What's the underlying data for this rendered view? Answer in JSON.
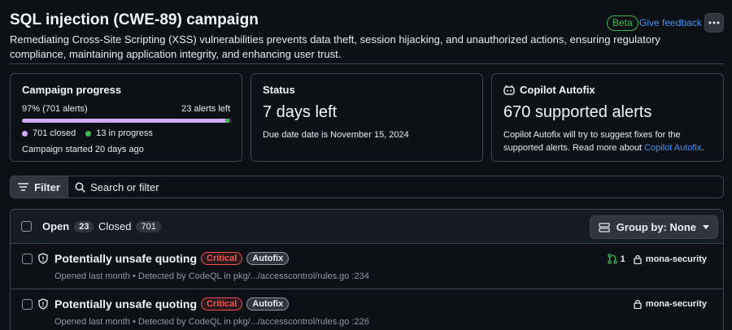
{
  "header": {
    "title": "SQL injection (CWE-89) campaign",
    "description": "Remediating Cross-Site Scripting (XSS) vulnerabilities prevents data theft, session hijacking, and unauthorized actions, ensuring regulatory compliance, maintaining application integrity, and enhancing user trust.",
    "beta_label": "Beta",
    "feedback_label": "Give feedback",
    "more_icon": "kebab-horizontal-icon"
  },
  "progress_card": {
    "title": "Campaign progress",
    "percent_label": "97% (701 alerts)",
    "remaining_label": "23 alerts left",
    "progress_fraction": 0.97,
    "closed_label": "701 closed",
    "in_progress_label": "13 in progress",
    "started_label": "Campaign started 20 days ago",
    "closed_color": "#d2a8ff",
    "in_progress_color": "#3fb950"
  },
  "status_card": {
    "title": "Status",
    "value": "7 days left",
    "due_label": "Due date date is November 15, 2024"
  },
  "autofix_card": {
    "title": "Copilot Autofix",
    "icon": "copilot-icon",
    "value": "670 supported alerts",
    "desc_prefix": "Copilot Autofix will try to suggest fixes for the supported alerts. Read more about ",
    "desc_link": "Copilot Autofix",
    "desc_suffix": "."
  },
  "filter": {
    "button_label": "Filter",
    "search_placeholder": "Search or filter"
  },
  "list": {
    "open_label": "Open",
    "open_count": "23",
    "closed_label": "Closed",
    "closed_count": "701",
    "groupby_label": "Group by: None",
    "rows": [
      {
        "title": "Potentially unsafe quoting",
        "severity": "Critical",
        "tag": "Autofix",
        "meta": "Opened last month • Detected by CodeQL in pkg/.../accesscontrol/rules.go :234",
        "pr_count": "1",
        "owner": "mona-security"
      },
      {
        "title": "Potentially unsafe quoting",
        "severity": "Critical",
        "tag": "Autofix",
        "meta": "Opened last month • Detected by CodeQL in pkg/.../accesscontrol/rules.go :226",
        "owner": "mona-security"
      }
    ]
  }
}
